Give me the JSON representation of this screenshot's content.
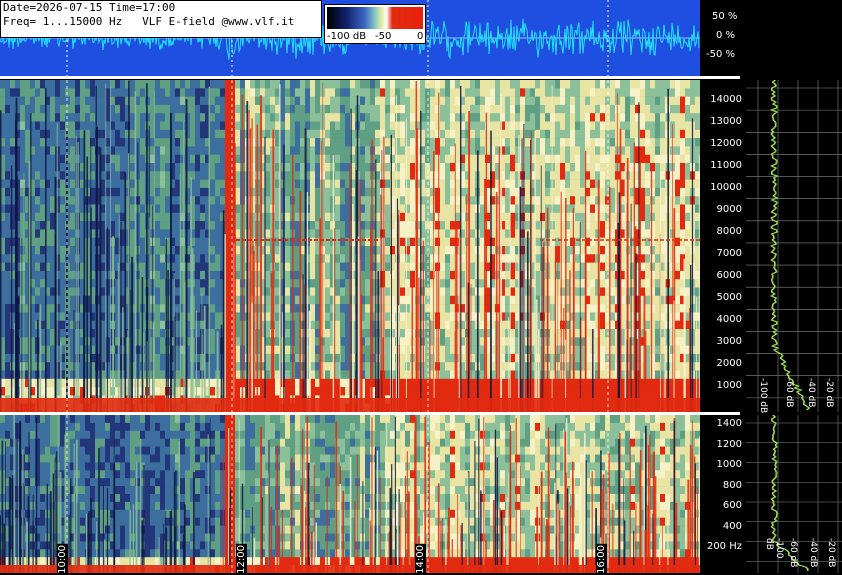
{
  "header": {
    "line1": "Date=2026-07-15 Time=17:00",
    "line2": "Freq= 1...15000 Hz   VLF E-field @www.vlf.it"
  },
  "colorbar": {
    "labels": [
      "-100 dB",
      "-50",
      "0"
    ]
  },
  "scope_scale": [
    "50 %",
    "0 %",
    "-50 %"
  ],
  "freq_axis_top": [
    "14000",
    "13000",
    "12000",
    "11000",
    "10000",
    "9000",
    "8000",
    "7000",
    "6000",
    "5000",
    "4000",
    "3000",
    "2000",
    "1000"
  ],
  "freq_axis_bottom": [
    "1400",
    "1200",
    "1000",
    "800",
    "600",
    "400",
    "200 Hz"
  ],
  "db_axis_top": [
    "-100 dB",
    "-60 dB",
    "-40 dB",
    "-20 dB"
  ],
  "db_axis_bottom": [
    "-100 dB",
    "-60 dB",
    "-40 dB",
    "-20 dB"
  ],
  "time_ticks": [
    "10:00",
    "12:00",
    "14:00",
    "16:00"
  ],
  "colors": {
    "scope_bg": "#1e4fe0",
    "scope_trace": "#22e0ff",
    "hot": "#e32b10",
    "warm": "#f2eca0",
    "cool": "#5fa88a",
    "cold": "#1a2a6a"
  }
}
